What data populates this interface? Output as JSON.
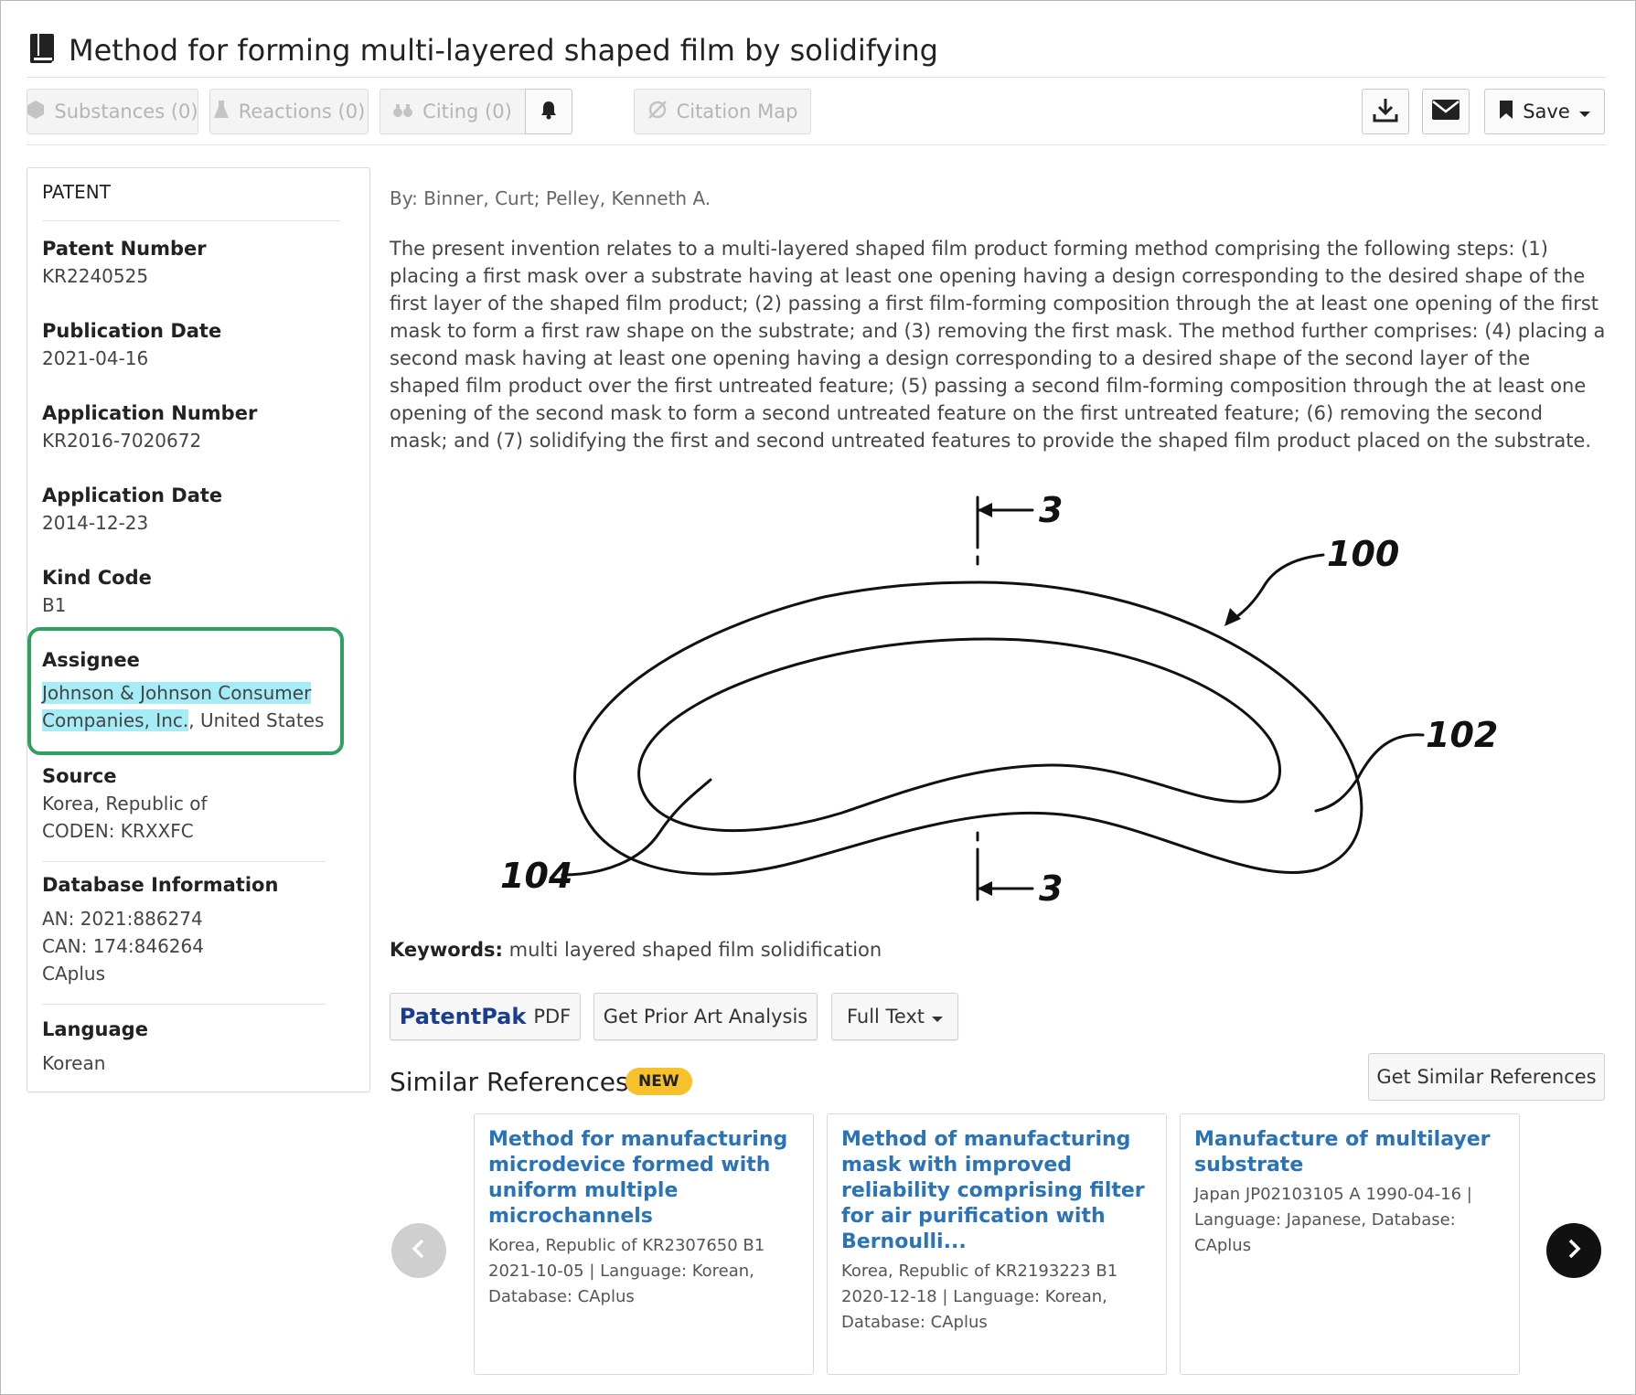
{
  "header": {
    "title": "Method for forming multi-layered shaped film by solidifying"
  },
  "toolbar": {
    "substances": "Substances (0)",
    "reactions": "Reactions (0)",
    "citing": "Citing (0)",
    "citation_map": "Citation Map",
    "save": "Save"
  },
  "sidebar": {
    "heading": "PATENT",
    "patent_number_label": "Patent Number",
    "patent_number": "KR2240525",
    "publication_date_label": "Publication Date",
    "publication_date": "2021-04-16",
    "application_number_label": "Application Number",
    "application_number": "KR2016-7020672",
    "application_date_label": "Application Date",
    "application_date": "2014-12-23",
    "kind_code_label": "Kind Code",
    "kind_code": "B1",
    "assignee_label": "Assignee",
    "assignee_name_line1": "Johnson & Johnson Consumer",
    "assignee_name_line2": "Companies, Inc.",
    "assignee_country": ", United States",
    "source_label": "Source",
    "source_line1": "Korea, Republic of",
    "source_line2": "CODEN: KRXXFC",
    "database_label": "Database Information",
    "db_an": "AN: 2021:886274",
    "db_can": "CAN: 174:846264",
    "db_name": "CAplus",
    "language_label": "Language",
    "language": "Korean"
  },
  "main": {
    "byline": "By: Binner, Curt; Pelley, Kenneth A.",
    "abstract": "The present invention relates to a multi-layered shaped film product forming method comprising the following steps: (1) placing a first mask over a substrate having at least one opening having a design corresponding to the desired shape of the first layer of the shaped film product; (2) passing a first film-forming composition through the at least one opening of the first mask to form a first raw shape on the substrate; and (3) removing the first mask. The method further comprises: (4) placing a second mask having at least one opening having a design corresponding to a desired shape of the second layer of the shaped film product over the first untreated feature; (5) passing a second film-forming composition through the at least one opening of the second mask to form a second untreated feature on the first untreated feature; (6) removing the second mask; and (7) solidifying the first and second untreated features to provide the shaped film product placed on the substrate.",
    "figure_labels": {
      "section_top": "3",
      "section_bottom": "3",
      "ref_100": "100",
      "ref_102": "102",
      "ref_104": "104"
    },
    "keywords_label": "Keywords:",
    "keywords": "multi layered shaped film solidification",
    "patentpak_brand": "PatentPak",
    "patentpak_pdf": "PDF",
    "prior_art": "Get Prior Art Analysis",
    "full_text": "Full Text"
  },
  "similar": {
    "title": "Similar References",
    "badge": "NEW",
    "get_button": "Get Similar References",
    "cards": [
      {
        "title": "Method for manufacturing microdevice formed with uniform multiple microchannels",
        "meta": "Korea, Republic of KR2307650 B1 2021-10-05 | Language: Korean, Database: CAplus"
      },
      {
        "title": "Method of manufacturing mask with improved reliability comprising filter for air purification with Bernoulli...",
        "meta": "Korea, Republic of KR2193223 B1 2020-12-18 | Language: Korean, Database: CAplus"
      },
      {
        "title": "Manufacture of multilayer substrate",
        "meta": "Japan JP02103105 A 1990-04-16 | Language: Japanese, Database: CAplus"
      }
    ]
  },
  "colors": {
    "assignee_outline": "#2ea060",
    "highlight": "#a6ecf7",
    "link": "#2a73b8",
    "badge": "#f7c12b"
  },
  "icons": [
    "book-icon",
    "hexagon-icon",
    "flask-icon",
    "quote-icon",
    "bell-icon",
    "map-icon",
    "download-icon",
    "envelope-icon",
    "bookmark-icon",
    "caret-down-icon",
    "chevron-left-icon",
    "chevron-right-icon"
  ]
}
